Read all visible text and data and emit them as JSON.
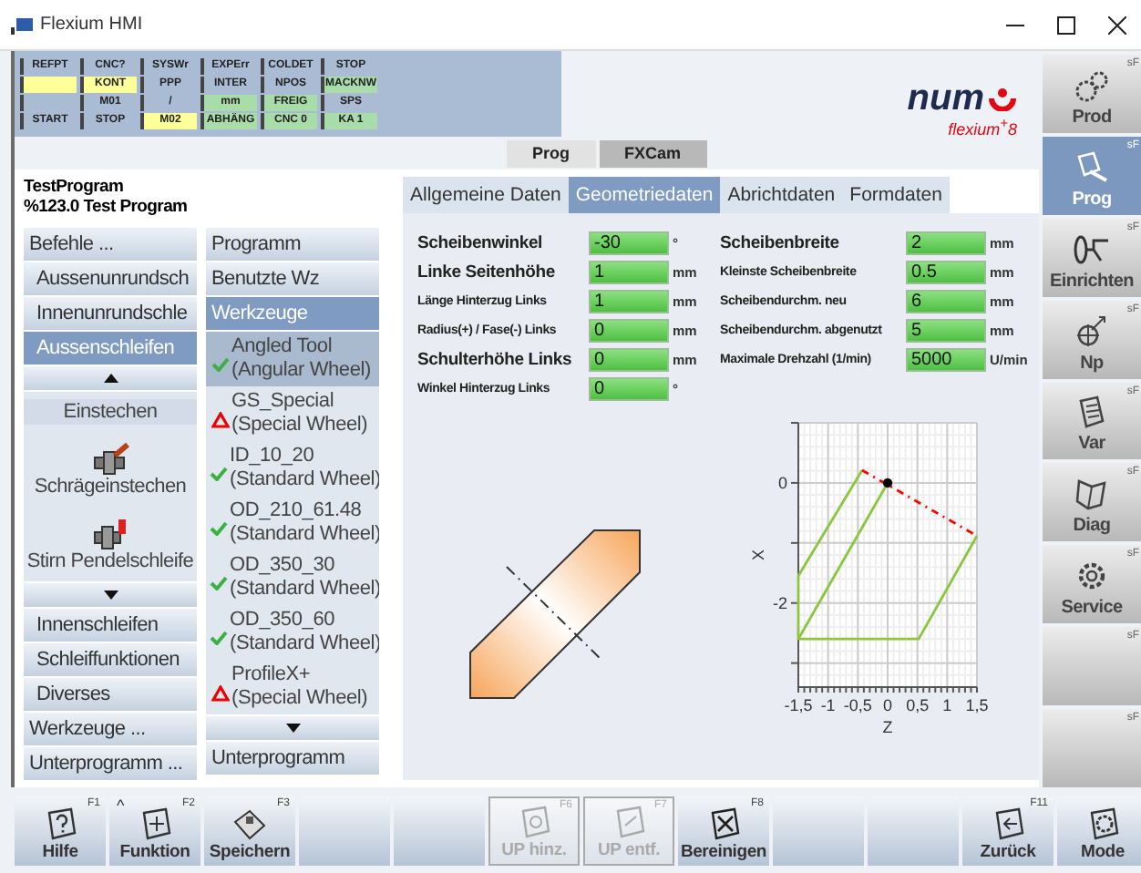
{
  "window": {
    "title": "Flexium HMI"
  },
  "status_grid": [
    [
      {
        "text": "REFPT",
        "color": "#a9bcd4"
      },
      {
        "text": "CNC?",
        "color": "#a9bcd4"
      },
      {
        "text": "SYSWr",
        "color": "#a9bcd4"
      },
      {
        "text": "EXPErr",
        "color": "#a9bcd4"
      },
      {
        "text": "COLDET",
        "color": "#a9bcd4"
      },
      {
        "text": "STOP",
        "color": "#a9bcd4"
      }
    ],
    [
      {
        "color": "#ffff99"
      },
      {
        "text": "KONT",
        "color": "#ffff99"
      },
      {
        "text": "PPP",
        "color": "#a9bcd4"
      },
      {
        "text": "INTER",
        "color": "#a9bcd4"
      },
      {
        "text": "NPOS",
        "color": "#a9bcd4"
      },
      {
        "text": "MACKNW",
        "color": "#a8dca8"
      }
    ],
    [
      {
        "color": "#a9bcd4"
      },
      {
        "text": "M01",
        "color": "#a9bcd4"
      },
      {
        "text": "/",
        "color": "#a9bcd4"
      },
      {
        "text": "mm",
        "color": "#a8dca8"
      },
      {
        "text": "FREIG",
        "color": "#a8dca8"
      },
      {
        "text": "SPS",
        "color": "#a9bcd4"
      }
    ],
    [
      {
        "text": "START",
        "color": "#a9bcd4"
      },
      {
        "text": "STOP",
        "color": "#a9bcd4"
      },
      {
        "text": "M02",
        "color": "#ffff99"
      },
      {
        "text": "ABHÄNG",
        "color": "#a8dca8"
      },
      {
        "text": "CNC 0",
        "color": "#a8dca8"
      },
      {
        "text": "KA 1",
        "color": "#a8dca8"
      }
    ]
  ],
  "logo": {
    "brand": "num",
    "product": "flexium$^{+}$8"
  },
  "mode_tabs": [
    {
      "label": "Prog",
      "selected": false
    },
    {
      "label": "FXCam",
      "selected": true
    }
  ],
  "program": {
    "name": "TestProgram",
    "description": "%123.0 Test Program"
  },
  "command_menu": [
    {
      "kind": "header",
      "label": "Befehle ...",
      "selected": false
    },
    {
      "kind": "sub",
      "label": "Aussenunrundsch",
      "selected": false
    },
    {
      "kind": "sub",
      "label": "Innenunrundschle",
      "selected": false
    },
    {
      "kind": "sub",
      "label": "Aussenschleifen",
      "selected": true
    },
    {
      "kind": "scroll_up"
    },
    {
      "kind": "cycles",
      "items": [
        {
          "kind": "plain",
          "label": "Einstechen",
          "selected": true
        },
        {
          "kind": "icon",
          "label": "Schrägeinstechen",
          "selected": false
        },
        {
          "kind": "icon",
          "label": "Stirn Pendelschleife",
          "selected": false
        }
      ]
    },
    {
      "kind": "scroll_down"
    },
    {
      "kind": "sub",
      "label": "Innenschleifen",
      "selected": false
    },
    {
      "kind": "sub",
      "label": "Schleiffunktionen",
      "selected": false
    },
    {
      "kind": "sub",
      "label": "Diverses",
      "selected": false
    },
    {
      "kind": "header",
      "label": "Werkzeuge ...",
      "selected": false
    },
    {
      "kind": "header",
      "label": "Unterprogramm ...",
      "selected": false
    }
  ],
  "tool_menu": {
    "items": [
      {
        "label": "Programm",
        "selected": false
      },
      {
        "label": "Benutzte Wz",
        "selected": false
      },
      {
        "label": "Werkzeuge",
        "selected": true
      }
    ],
    "tools": [
      {
        "name": "Angled Tool",
        "type": "(Angular Wheel)",
        "kind": "ok",
        "selected": true
      },
      {
        "name": "GS_Special",
        "type": "(Special Wheel)",
        "kind": "warning",
        "selected": false
      },
      {
        "name": "ID_10_20",
        "type": "(Standard Wheel)",
        "kind": "ok",
        "selected": false
      },
      {
        "name": "OD_210_61.48",
        "type": "(Standard Wheel)",
        "kind": "ok",
        "selected": false
      },
      {
        "name": "OD_350_30",
        "type": "(Standard Wheel)",
        "kind": "ok",
        "selected": false
      },
      {
        "name": "OD_350_60",
        "type": "(Standard Wheel)",
        "kind": "ok",
        "selected": false
      },
      {
        "name": "ProfileX+",
        "type": "(Special Wheel)",
        "kind": "warning",
        "selected": false
      }
    ],
    "footer": {
      "label": "Unterprogramm",
      "selected": false
    }
  },
  "form": {
    "tabs": [
      {
        "label": "Allgemeine Daten",
        "selected": false
      },
      {
        "label": "Geometriedaten",
        "selected": true
      },
      {
        "label": "Abrichtdaten",
        "selected": false
      },
      {
        "label": "Formdaten",
        "selected": false
      }
    ],
    "fields_left": [
      {
        "kind": "large",
        "label": "Scheibenwinkel",
        "value": "-30",
        "unit": "°"
      },
      {
        "kind": "large",
        "label": "Linke Seitenhöhe",
        "value": "1",
        "unit": "mm"
      },
      {
        "kind": "small",
        "label": "Länge Hinterzug Links",
        "value": "1",
        "unit": "mm"
      },
      {
        "kind": "small",
        "label": "Radius(+) / Fase(-) Links",
        "value": "0",
        "unit": "mm"
      },
      {
        "kind": "large",
        "label": "Schulterhöhe Links",
        "value": "0",
        "unit": "mm"
      },
      {
        "kind": "small",
        "label": "Winkel Hinterzug Links",
        "value": "0",
        "unit": "°"
      }
    ],
    "fields_right": [
      {
        "kind": "large",
        "label": "Scheibenbreite",
        "value": "2",
        "unit": "mm"
      },
      {
        "kind": "small",
        "label": "Kleinste Scheibenbreite",
        "value": "0.5",
        "unit": "mm"
      },
      {
        "kind": "small",
        "label": "Scheibendurchm. neu",
        "value": "6",
        "unit": "mm"
      },
      {
        "kind": "small",
        "label": "Scheibendurchm. abgenutzt",
        "value": "5",
        "unit": "mm"
      },
      {
        "kind": "small",
        "label": "Maximale Drehzahl (1/min)",
        "value": "5000",
        "unit": "U/min"
      }
    ],
    "chart_data": {
      "type": "line",
      "xlabel": "Z",
      "ylabel": "X",
      "xlim": [
        -1.5,
        1.5
      ],
      "ylim": [
        -3.4,
        1
      ],
      "xticks": [
        {
          "value": -1.5,
          "label": "-1,5"
        },
        {
          "value": -1,
          "label": "-1"
        },
        {
          "value": -0.5,
          "label": "-0,5"
        },
        {
          "value": 0,
          "label": "0"
        },
        {
          "value": 0.5,
          "label": "0,5"
        },
        {
          "value": 1,
          "label": "1"
        },
        {
          "value": 1.5,
          "label": "1,5"
        }
      ],
      "yticks": [
        0,
        -2
      ],
      "series": [
        {
          "line_style": "solid",
          "color": "#8cc63f",
          "x": [
            -0.43,
            -1.5,
            -1.5,
            0.52,
            1.5
          ],
          "values": [
            0.21,
            -1.55,
            -2.6,
            -2.6,
            -0.88
          ]
        },
        {
          "line_style": "solid",
          "color": "#8cc63f",
          "x": [
            -1.5,
            0
          ],
          "values": [
            -2.6,
            0
          ]
        },
        {
          "line_style": "dashed",
          "color": "#ff0000",
          "x": [
            -0.43,
            1.5
          ],
          "values": [
            0.21,
            -0.88
          ]
        },
        {
          "line_style": "none",
          "marker": "dot",
          "color": "#000000",
          "x": [
            0
          ],
          "values": [
            0
          ]
        }
      ],
      "grid": true
    }
  },
  "side_buttons": [
    {
      "label": "Prod",
      "fkey": "sF",
      "selected": false
    },
    {
      "label": "Prog",
      "fkey": "sF",
      "selected": true
    },
    {
      "label": "Einrichten",
      "fkey": "sF",
      "selected": false
    },
    {
      "label": "Np",
      "fkey": "sF",
      "selected": false
    },
    {
      "label": "Var",
      "fkey": "sF",
      "selected": false
    },
    {
      "label": "Diag",
      "fkey": "sF",
      "selected": false
    },
    {
      "label": "Service",
      "fkey": "sF",
      "selected": false
    },
    {
      "fkey": "sF",
      "selected": false
    },
    {
      "fkey": "sF",
      "selected": false
    }
  ],
  "toolbar": [
    {
      "label": "Hilfe",
      "fkey": "F1",
      "disabled": false
    },
    {
      "label": "Funktion",
      "fkey": "F2",
      "corner": "^",
      "disabled": false
    },
    {
      "label": "Speichern",
      "fkey": "F3",
      "disabled": false
    },
    {
      "disabled": false
    },
    {
      "disabled": false
    },
    {
      "label": "UP hinz.",
      "fkey": "F6",
      "disabled": true
    },
    {
      "label": "UP entf.",
      "fkey": "F7",
      "disabled": true
    },
    {
      "label": "Bereinigen",
      "fkey": "F8",
      "disabled": false
    },
    {
      "disabled": false
    },
    {
      "disabled": false
    },
    {
      "label": "Zurück",
      "fkey": "F11",
      "disabled": false
    },
    {
      "label": "Mode",
      "disabled": false
    }
  ]
}
